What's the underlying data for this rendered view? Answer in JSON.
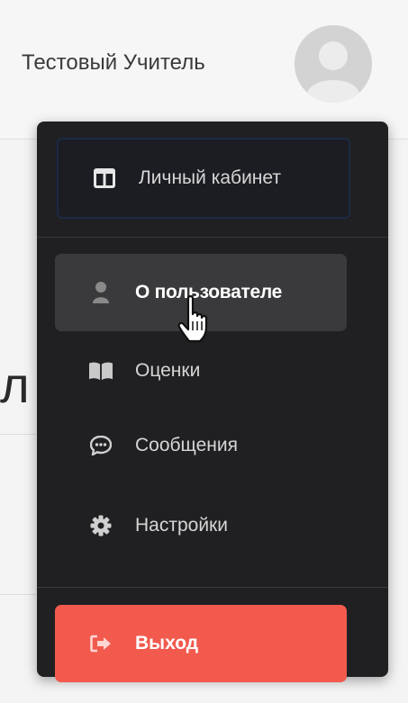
{
  "header": {
    "user_name": "Тестовый Учитель"
  },
  "background": {
    "partial_letter": "л"
  },
  "menu": {
    "items": [
      {
        "label": "Личный кабинет",
        "icon": "columns-icon"
      },
      {
        "label": "О пользователе",
        "icon": "user-icon"
      },
      {
        "label": "Оценки",
        "icon": "book-open-icon"
      },
      {
        "label": "Сообщения",
        "icon": "comment-dots-icon"
      },
      {
        "label": "Настройки",
        "icon": "gear-icon"
      }
    ],
    "logout": {
      "label": "Выход",
      "icon": "sign-out-icon"
    }
  },
  "colors": {
    "menu_background": "#202023",
    "hover_item": "#3a3a3d",
    "logout_button": "#f25a4e"
  }
}
